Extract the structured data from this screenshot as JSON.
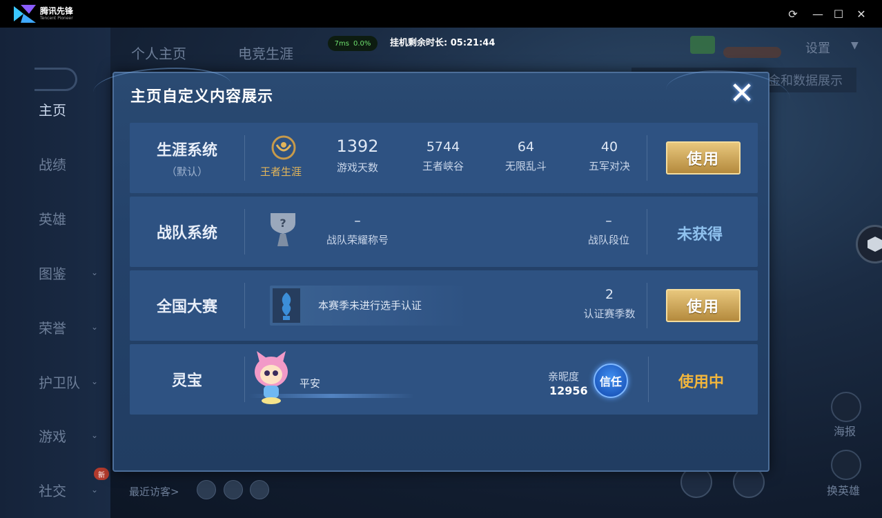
{
  "window": {
    "app_name": "腾讯先锋",
    "app_name_en": "Tencent Pioneer",
    "refresh_icon": "refresh-icon",
    "minimize_icon": "minimize-icon",
    "maximize_icon": "maximize-icon",
    "close_icon": "close-icon"
  },
  "status": {
    "ping": "7ms",
    "loss": "0.0%",
    "hang_time": "挂机剩余时长: 05:21:44"
  },
  "background": {
    "top_tabs": [
      "个人主页",
      "电竞生涯"
    ],
    "setting_label": "设置",
    "strip_label": "金和数据展示",
    "recent_visitors": "最近访客>",
    "new_badge": "新",
    "right_buttons": [
      "海报",
      "换英雄"
    ]
  },
  "nav": {
    "items": [
      {
        "label": "主页",
        "active": true,
        "has_chevron": false
      },
      {
        "label": "战绩",
        "active": false,
        "has_chevron": false
      },
      {
        "label": "英雄",
        "active": false,
        "has_chevron": false
      },
      {
        "label": "图鉴",
        "active": false,
        "has_chevron": true
      },
      {
        "label": "荣誉",
        "active": false,
        "has_chevron": true
      },
      {
        "label": "护卫队",
        "active": false,
        "has_chevron": true
      },
      {
        "label": "游戏",
        "active": false,
        "has_chevron": true
      },
      {
        "label": "社交",
        "active": false,
        "has_chevron": true
      }
    ]
  },
  "dialog": {
    "title": "主页自定义内容展示",
    "close_label": "✕",
    "rows": {
      "career": {
        "title": "生涯系统",
        "subtitle": "（默认）",
        "emblem_label": "王者生涯",
        "stats": [
          {
            "value": "1392",
            "label": "游戏天数"
          },
          {
            "value": "5744",
            "label": "王者峡谷"
          },
          {
            "value": "64",
            "label": "无限乱斗"
          },
          {
            "value": "40",
            "label": "五军对决"
          }
        ],
        "action": "使用"
      },
      "team": {
        "title": "战队系统",
        "honor_value": "–",
        "honor_label": "战队荣耀称号",
        "rank_value": "–",
        "rank_label": "战队段位",
        "status": "未获得"
      },
      "national": {
        "title": "全国大赛",
        "cert_text": "本赛季未进行选手认证",
        "season_value": "2",
        "season_label": "认证赛季数",
        "action": "使用"
      },
      "pet": {
        "title": "灵宝",
        "pet_name": "平安",
        "intimacy_label": "亲昵度",
        "intimacy_value": "12956",
        "trust_badge": "信任",
        "status": "使用中"
      }
    }
  },
  "colors": {
    "gold": "#e1b45a",
    "not_obtained": "#8fc1ee",
    "in_use": "#f2b63c"
  }
}
